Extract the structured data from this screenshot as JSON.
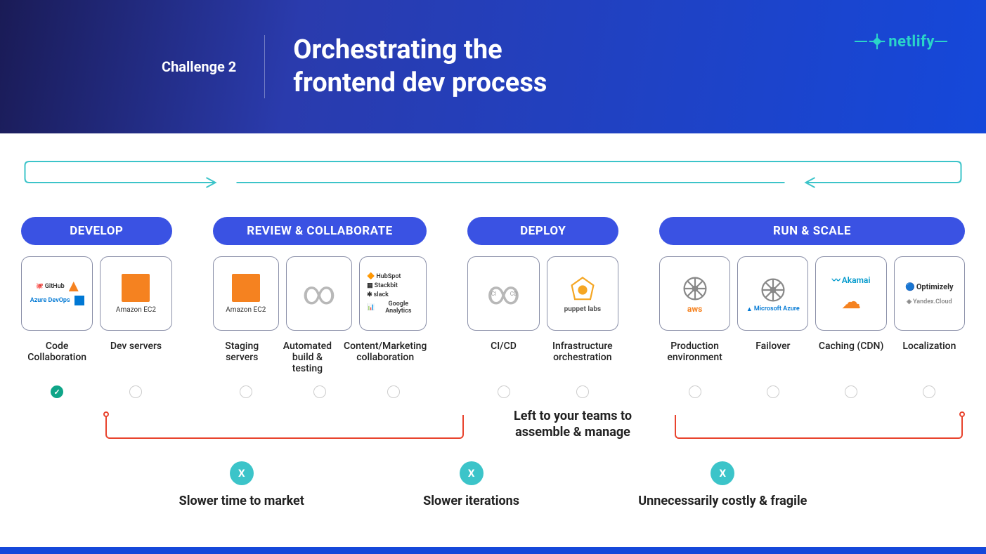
{
  "header": {
    "challenge_label": "Challenge 2",
    "title_line1": "Orchestrating the",
    "title_line2": "frontend dev process",
    "brand": "netlify"
  },
  "stages": [
    {
      "key": "develop",
      "label": "DEVELOP",
      "items": [
        {
          "key": "code-collab",
          "label": "Code Collaboration",
          "checked": true,
          "icons": [
            "GitHub",
            "GitLab",
            "Azure DevOps",
            "Bitbucket"
          ]
        },
        {
          "key": "dev-servers",
          "label": "Dev servers",
          "checked": false,
          "icons": [
            "Amazon EC2"
          ]
        }
      ]
    },
    {
      "key": "review",
      "label": "REVIEW & COLLABORATE",
      "items": [
        {
          "key": "staging",
          "label": "Staging servers",
          "checked": false,
          "icons": [
            "Amazon EC2"
          ]
        },
        {
          "key": "automated",
          "label": "Automated build & testing",
          "checked": false,
          "icons": [
            "infinity"
          ]
        },
        {
          "key": "content-mkt",
          "label": "Content/Marketing collaboration",
          "checked": false,
          "icons": [
            "HubSpot",
            "Stackbit",
            "slack",
            "Google Analytics"
          ]
        }
      ]
    },
    {
      "key": "deploy",
      "label": "DEPLOY",
      "items": [
        {
          "key": "cicd",
          "label": "CI/CD",
          "checked": false,
          "icons": [
            "CI-CD"
          ]
        },
        {
          "key": "infra",
          "label": "Infrastructure orchestration",
          "checked": false,
          "icons": [
            "puppet labs"
          ]
        }
      ]
    },
    {
      "key": "run",
      "label": "RUN & SCALE",
      "items": [
        {
          "key": "prod",
          "label": "Production environment",
          "checked": false,
          "icons": [
            "aws",
            "k8s"
          ]
        },
        {
          "key": "failover",
          "label": "Failover",
          "checked": false,
          "icons": [
            "k8s",
            "Microsoft Azure"
          ]
        },
        {
          "key": "cdn",
          "label": "Caching (CDN)",
          "checked": false,
          "icons": [
            "Akamai",
            "Cloudflare"
          ]
        },
        {
          "key": "local",
          "label": "Localization",
          "checked": false,
          "icons": [
            "Optimizely",
            "Yandex.Cloud"
          ]
        }
      ]
    }
  ],
  "center_note_line1": "Left to your teams to",
  "center_note_line2": "assemble & manage",
  "issues": [
    {
      "key": "time",
      "text": "Slower time to market"
    },
    {
      "key": "iter",
      "text": "Slower iterations"
    },
    {
      "key": "cost",
      "text": "Unnecessarily costly & fragile"
    }
  ],
  "icon_labels": {
    "ec2": "Amazon EC2",
    "aws": "aws",
    "azure": "Microsoft Azure",
    "puppet": "puppet labs",
    "akamai": "Akamai",
    "optimizely": "Optimizely",
    "yandex": "Yandex.Cloud",
    "hubspot": "HubSpot",
    "stackbit": "Stackbit",
    "slack": "slack",
    "ga": "Google Analytics",
    "github": "GitHub",
    "azuredevops": "Azure DevOps",
    "ci": "CI",
    "cd": "CD"
  },
  "colors": {
    "accent": "#2ad4c9",
    "pill": "#3a52e3",
    "danger": "#e8432d",
    "check": "#0fa588"
  }
}
